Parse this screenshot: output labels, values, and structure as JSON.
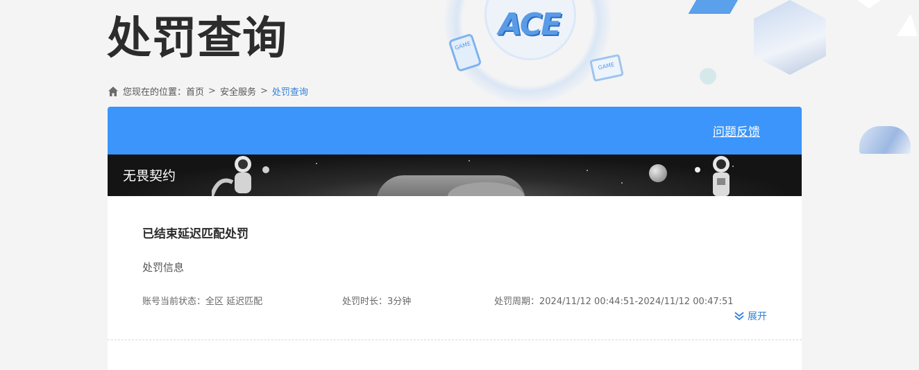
{
  "page": {
    "title": "处罚查询"
  },
  "breadcrumb": {
    "prefix": "您现在的位置：",
    "items": [
      "首页",
      "安全服务",
      "处罚查询"
    ],
    "separator": ">"
  },
  "header": {
    "feedback_label": "问题反馈",
    "accent_color": "#3b95fa"
  },
  "banner": {
    "game_name": "无畏契约"
  },
  "penalty": {
    "title": "已结束延迟匹配处罚",
    "section_label": "处罚信息",
    "status": "账号当前状态：全区 延迟匹配",
    "duration": "处罚时长：3分钟",
    "period": "处罚周期：2024/11/12 00:44:51-2024/11/12 00:47:51",
    "expand_label": "展开"
  },
  "icons": {
    "home": "home-icon",
    "expand": "double-chevron-down-icon"
  },
  "decor": {
    "logo_text": "ACE",
    "phone_text": "GAME",
    "tv_text": "GAME"
  }
}
